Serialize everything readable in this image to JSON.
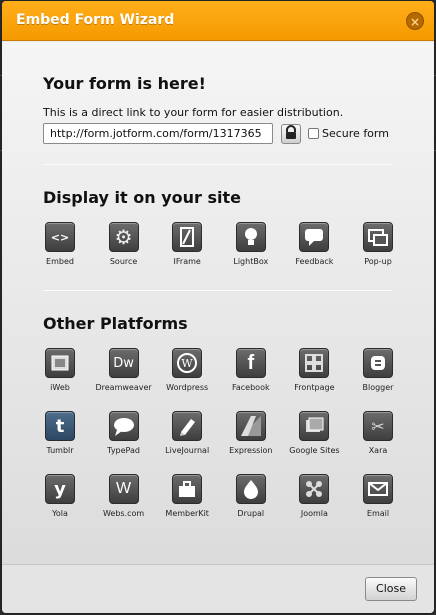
{
  "dialog": {
    "title": "Embed Form Wizard",
    "close_x": "×",
    "close_button": "Close"
  },
  "link_section": {
    "heading": "Your form is here!",
    "description": "This is a direct link to your form for easier distribution.",
    "url_value": "http://form.jotform.com/form/1317365",
    "secure_label": "Secure form",
    "secure_checked": false
  },
  "display_section": {
    "heading": "Display it on your site",
    "items": [
      {
        "label": "Embed",
        "icon": "code-brackets-icon"
      },
      {
        "label": "Source",
        "icon": "gear-icon"
      },
      {
        "label": "IFrame",
        "icon": "iframe-icon"
      },
      {
        "label": "LightBox",
        "icon": "lightbulb-icon"
      },
      {
        "label": "Feedback",
        "icon": "speech-bubble-icon"
      },
      {
        "label": "Pop-up",
        "icon": "popup-windows-icon"
      }
    ]
  },
  "platforms_section": {
    "heading": "Other Platforms",
    "items": [
      {
        "label": "iWeb",
        "icon": "iweb-icon"
      },
      {
        "label": "Dreamweaver",
        "icon": "dreamweaver-icon"
      },
      {
        "label": "Wordpress",
        "icon": "wordpress-icon"
      },
      {
        "label": "Facebook",
        "icon": "facebook-icon"
      },
      {
        "label": "Frontpage",
        "icon": "frontpage-icon"
      },
      {
        "label": "Blogger",
        "icon": "blogger-icon"
      },
      {
        "label": "Tumblr",
        "icon": "tumblr-icon"
      },
      {
        "label": "TypePad",
        "icon": "typepad-icon"
      },
      {
        "label": "LiveJournal",
        "icon": "livejournal-icon"
      },
      {
        "label": "Expression",
        "icon": "expression-icon"
      },
      {
        "label": "Google Sites",
        "icon": "google-sites-icon"
      },
      {
        "label": "Xara",
        "icon": "xara-icon"
      },
      {
        "label": "Yola",
        "icon": "yola-icon"
      },
      {
        "label": "Webs.com",
        "icon": "webs-icon"
      },
      {
        "label": "MemberKit",
        "icon": "memberkit-icon"
      },
      {
        "label": "Drupal",
        "icon": "drupal-icon"
      },
      {
        "label": "Joomla",
        "icon": "joomla-icon"
      },
      {
        "label": "Email",
        "icon": "email-icon"
      }
    ]
  },
  "colors": {
    "titlebar": "#f59a00",
    "tile": "#4a4a4a"
  }
}
